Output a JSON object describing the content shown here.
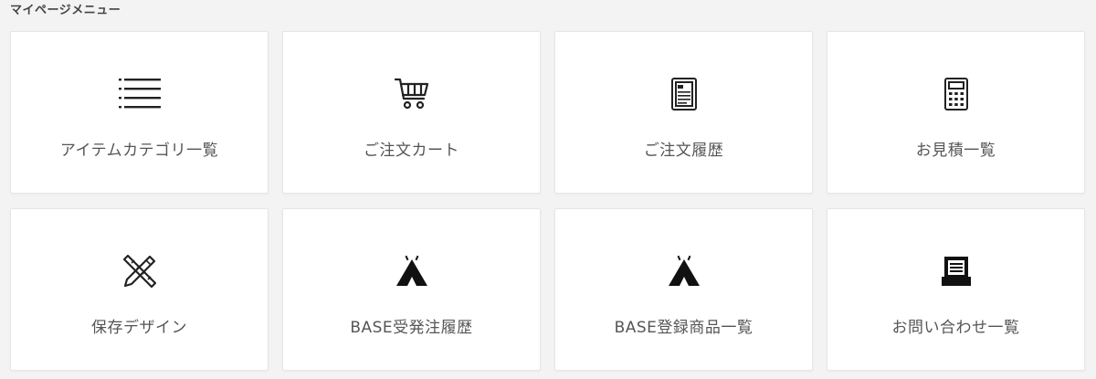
{
  "section": {
    "title": "マイページメニュー"
  },
  "menu": {
    "items": [
      {
        "label": "アイテムカテゴリ一覧",
        "icon": "list-icon"
      },
      {
        "label": "ご注文カート",
        "icon": "shopping-cart-icon"
      },
      {
        "label": "ご注文履歴",
        "icon": "order-history-icon"
      },
      {
        "label": "お見積一覧",
        "icon": "calculator-icon"
      },
      {
        "label": "保存デザイン",
        "icon": "design-tools-icon"
      },
      {
        "label": "BASE受発注履歴",
        "icon": "tent-icon"
      },
      {
        "label": "BASE登録商品一覧",
        "icon": "tent-icon"
      },
      {
        "label": "お問い合わせ一覧",
        "icon": "inquiry-document-icon"
      }
    ]
  },
  "colors": {
    "background": "#f3f3f3",
    "card": "#ffffff",
    "text": "#555555",
    "icon": "#222222"
  }
}
